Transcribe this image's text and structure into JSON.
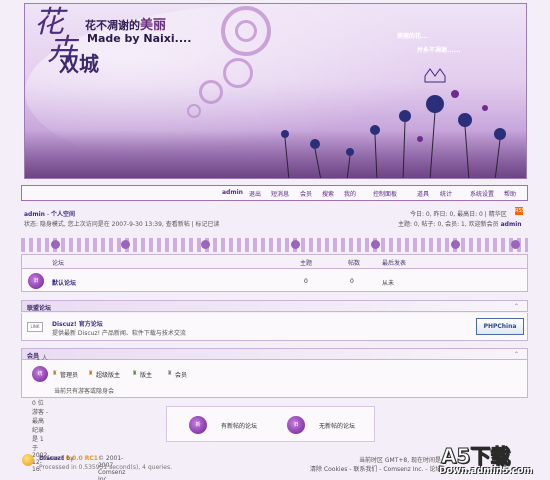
{
  "banner": {
    "title_top": "花",
    "title_bottom": "卉",
    "title_city": "双城",
    "sub_prefix": "花不凋谢的",
    "sub_highlight": "美丽",
    "made_by": "Made by Naixi....",
    "right_line1": "美丽的花...",
    "right_line2": "并永不凋谢......"
  },
  "nav": {
    "items": [
      "admin",
      "退出",
      "短消息",
      "会员",
      "搜索",
      "我的",
      "控制面板",
      "道具",
      "统计",
      "系统设置",
      "帮助"
    ]
  },
  "user": {
    "name": "admin",
    "space": "个人空间",
    "status": "状态: 隐身模式, 您上次访问是在  2007-9-30 13:39, 查看新帖  | 标记已读",
    "stats_line1": "今日: 0, 昨日: 0, 最高日: 0  | 精华区",
    "stats_line2_prefix": "主题: 0, 帖子: 0, 会员: 1, 欢迎新会员",
    "stats_line2_user": "admin",
    "rss": "RSS"
  },
  "forum_table": {
    "headers": [
      "论坛",
      "主题",
      "帖数",
      "最后发表"
    ],
    "rows": [
      {
        "name": "默认论坛",
        "topics": "0",
        "posts": "0",
        "last": "从未",
        "icon": "旧"
      }
    ]
  },
  "links": {
    "title": "联盟论坛",
    "logo_text": "LINK",
    "name": "Discuz! 官方论坛",
    "desc": "提供最新 Discuz! 产品新闻、软件下载与技术交流",
    "partner": "PHPChina"
  },
  "online": {
    "title": "会员",
    "summary": "- 1 人在线  - 1 会员(1 隐身), 0 位游客  - 最高纪录是 1  于 2002-12-16.",
    "legend_icon": "统",
    "roles": [
      "管理员",
      "超级版主",
      "版主",
      "会员"
    ],
    "note": "当前只有游客或隐身会"
  },
  "legend": {
    "new_icon": "新",
    "new_label": "有新帖的论坛",
    "none_icon": "旧",
    "none_label": "无新帖的论坛"
  },
  "footer": {
    "powered_prefix": "Powered by",
    "brand": "Discuz!",
    "version": "6.0.0 RC1",
    "copyright": "© 2001-2007 Comsenz Inc.",
    "processed": "Processed in 0.535951 second(s), 4 queries.",
    "tz": "当前时区  GMT+8, 现在时间是",
    "links": "清除  Cookies - 联系我们  - Comsenz Inc. - 论坛"
  },
  "watermark": {
    "big": "A5下载",
    "url": "Down.admin5.com"
  },
  "colors": {
    "accent": "#5b2b8a",
    "border": "#9c6fb9",
    "background": "#f3eef7"
  }
}
